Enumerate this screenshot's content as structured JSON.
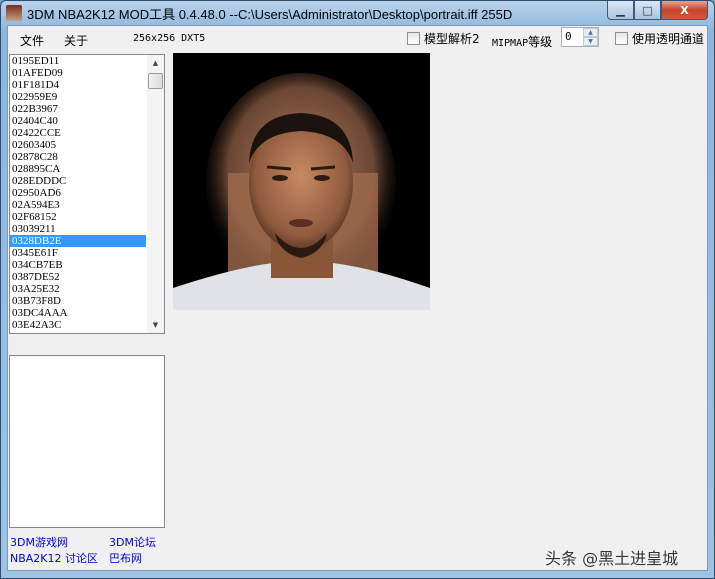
{
  "window": {
    "title": "3DM NBA2K12 MOD工具 0.4.48.0 --C:\\Users\\Administrator\\Desktop\\portrait.iff  255D",
    "minimize": "▁",
    "maximize": "□",
    "close": "X"
  },
  "menu": {
    "file": "文件",
    "about": "关于"
  },
  "texture_info": "256x256 DXT5",
  "options": {
    "model_parse_label": "模型解析2",
    "model_parse_checked": false,
    "mipmap_label_latin": "MIPMAP",
    "mipmap_label_cn": "等级",
    "mipmap_value": "0",
    "alpha_label": "使用透明通道",
    "alpha_checked": false
  },
  "list": {
    "items": [
      "0195ED11",
      "01AFED09",
      "01F181D4",
      "022959E9",
      "022B3967",
      "02404C40",
      "02422CCE",
      "02603405",
      "02878C28",
      "028895CA",
      "028EDDDC",
      "02950AD6",
      "02A594E3",
      "02F68152",
      "03039211",
      "0328DB2E",
      "0345E61F",
      "034CB7EB",
      "0387DE52",
      "03A25E32",
      "03B73F8D",
      "03DC4AAA",
      "03E42A3C"
    ],
    "selected": "0328DB2E",
    "selected_index": 15
  },
  "links": {
    "game": "3DM游戏网",
    "forum": "3DM论坛",
    "nba_forum": "NBA2K12 讨论区",
    "babu": "巴布网"
  },
  "watermark": "头条 @黑土进皇城",
  "colors": {
    "selection": "#3399ff",
    "link": "#0000ee"
  }
}
